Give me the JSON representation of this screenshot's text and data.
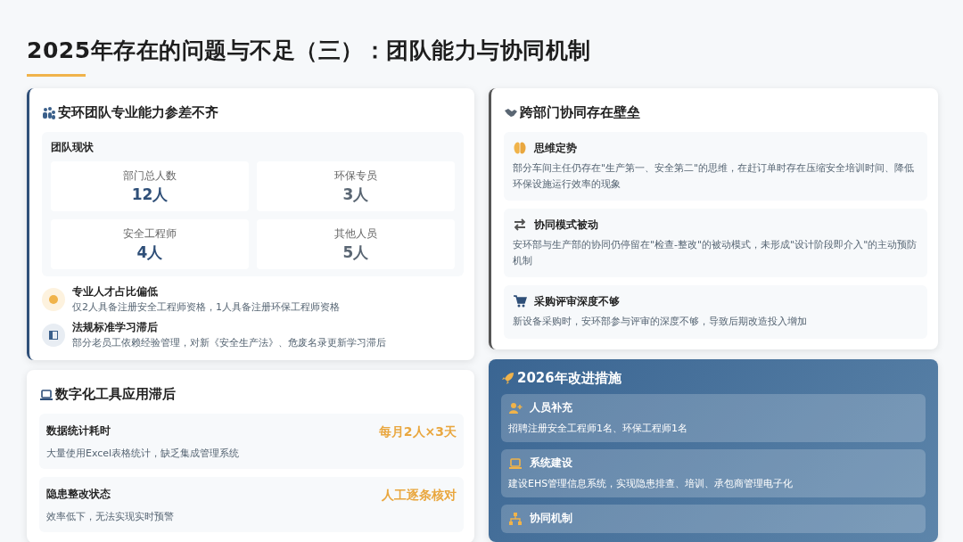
{
  "title": "2025年存在的问题与不足（三）：团队能力与协同机制",
  "team_card": {
    "heading": "安环团队专业能力参差不齐",
    "status_label": "团队现状",
    "stats": [
      {
        "label": "部门总人数",
        "value": "12人",
        "color": "#2f4f78"
      },
      {
        "label": "环保专员",
        "value": "3人",
        "color": "#5a6673"
      },
      {
        "label": "安全工程师",
        "value": "4人",
        "color": "#2f4f78"
      },
      {
        "label": "其他人员",
        "value": "5人",
        "color": "#5a6673"
      }
    ],
    "issues": [
      {
        "title": "专业人才占比偏低",
        "text": "仅2人具备注册安全工程师资格，1人具备注册环保工程师资格"
      },
      {
        "title": "法规标准学习滞后",
        "text": "部分老员工依赖经验管理，对新《安全生产法》、危废名录更新学习滞后"
      }
    ]
  },
  "digital_card": {
    "heading": "数字化工具应用滞后",
    "rows": [
      {
        "title": "数据统计耗时",
        "text": "大量使用Excel表格统计，缺乏集成管理系统",
        "figure": "每月2人×3天"
      },
      {
        "title": "隐患整改状态",
        "text": "效率低下，无法实现实时预警",
        "figure": "人工逐条核对"
      }
    ]
  },
  "collab_card": {
    "heading": "跨部门协同存在壁垒",
    "items": [
      {
        "title": "思维定势",
        "text": "部分车间主任仍存在\"生产第一、安全第二\"的思维，在赶订单时存在压缩安全培训时间、降低环保设施运行效率的现象"
      },
      {
        "title": "协同模式被动",
        "text": "安环部与生产部的协同仍停留在\"检查-整改\"的被动模式，未形成\"设计阶段即介入\"的主动预防机制"
      },
      {
        "title": "采购评审深度不够",
        "text": "新设备采购时，安环部参与评审的深度不够，导致后期改造投入增加"
      }
    ]
  },
  "measures_card": {
    "heading": "2026年改进措施",
    "items": [
      {
        "title": "人员补充",
        "text": "招聘注册安全工程师1名、环保工程师1名"
      },
      {
        "title": "系统建设",
        "text": "建设EHS管理信息系统，实现隐患排查、培训、承包商管理电子化"
      },
      {
        "title": "协同机制"
      }
    ]
  }
}
